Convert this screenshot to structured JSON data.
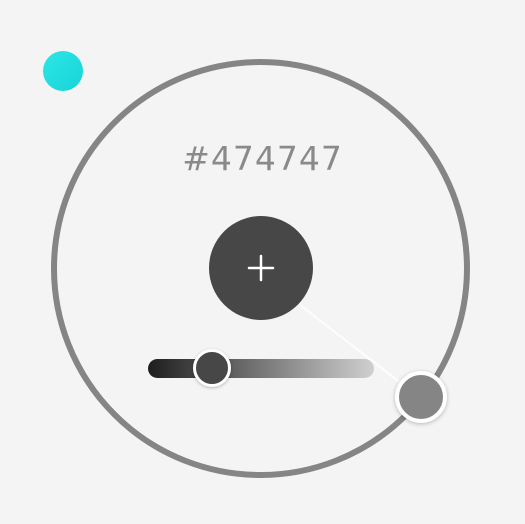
{
  "picker": {
    "hex_value": "#474747",
    "selected_color": "#474747",
    "accent_color": "#2ee6e6",
    "accent_gradient_end": "#16d4d8",
    "ring_color": "#858585",
    "handle_color": "#858585",
    "add_icon": "plus-icon"
  },
  "lightness_slider": {
    "value_fraction": 0.28,
    "gradient_start": "#1e1e1e",
    "gradient_end": "#d0d0d0",
    "thumb_color": "#474747"
  }
}
